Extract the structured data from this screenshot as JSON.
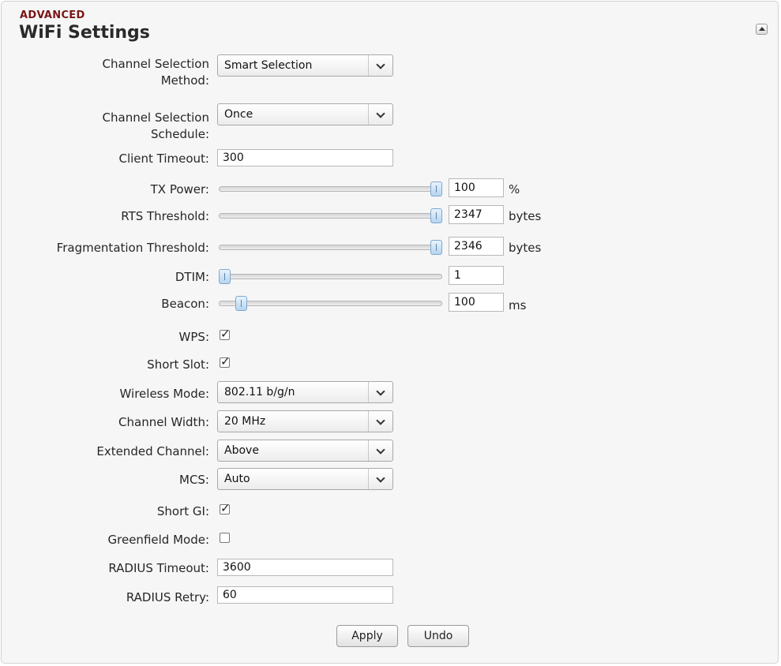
{
  "section": {
    "label": "ADVANCED",
    "title": "WiFi Settings"
  },
  "fields": {
    "channel_method": {
      "label_line1": "Channel Selection",
      "label_line2": "Method:",
      "value": "Smart Selection"
    },
    "channel_schedule": {
      "label_line1": "Channel Selection",
      "label_line2": "Schedule:",
      "value": "Once"
    },
    "client_timeout": {
      "label": "Client Timeout:",
      "value": "300"
    },
    "tx_power": {
      "label": "TX Power:",
      "value": "100",
      "unit": "%"
    },
    "rts_threshold": {
      "label": "RTS Threshold:",
      "value": "2347",
      "unit": "bytes"
    },
    "frag_threshold": {
      "label": "Fragmentation Threshold:",
      "value": "2346",
      "unit": "bytes"
    },
    "dtim": {
      "label": "DTIM:",
      "value": "1"
    },
    "beacon": {
      "label": "Beacon:",
      "value": "100",
      "unit": "ms"
    },
    "wps": {
      "label": "WPS:",
      "checked": true
    },
    "short_slot": {
      "label": "Short Slot:",
      "checked": true
    },
    "wireless_mode": {
      "label": "Wireless Mode:",
      "value": "802.11 b/g/n"
    },
    "channel_width": {
      "label": "Channel Width:",
      "value": "20 MHz"
    },
    "extended_channel": {
      "label": "Extended Channel:",
      "value": "Above"
    },
    "mcs": {
      "label": "MCS:",
      "value": "Auto"
    },
    "short_gi": {
      "label": "Short GI:",
      "checked": true
    },
    "greenfield": {
      "label": "Greenfield Mode:",
      "checked": false
    },
    "radius_timeout": {
      "label": "RADIUS Timeout:",
      "value": "3600"
    },
    "radius_retry": {
      "label": "RADIUS Retry:",
      "value": "60"
    }
  },
  "sliders": {
    "tx_power_level": 1.0,
    "rts_threshold_level": 1.0,
    "frag_threshold_level": 1.0,
    "dtim_level": 0.0,
    "beacon_level": 0.08
  },
  "buttons": {
    "apply": "Apply",
    "undo": "Undo"
  }
}
